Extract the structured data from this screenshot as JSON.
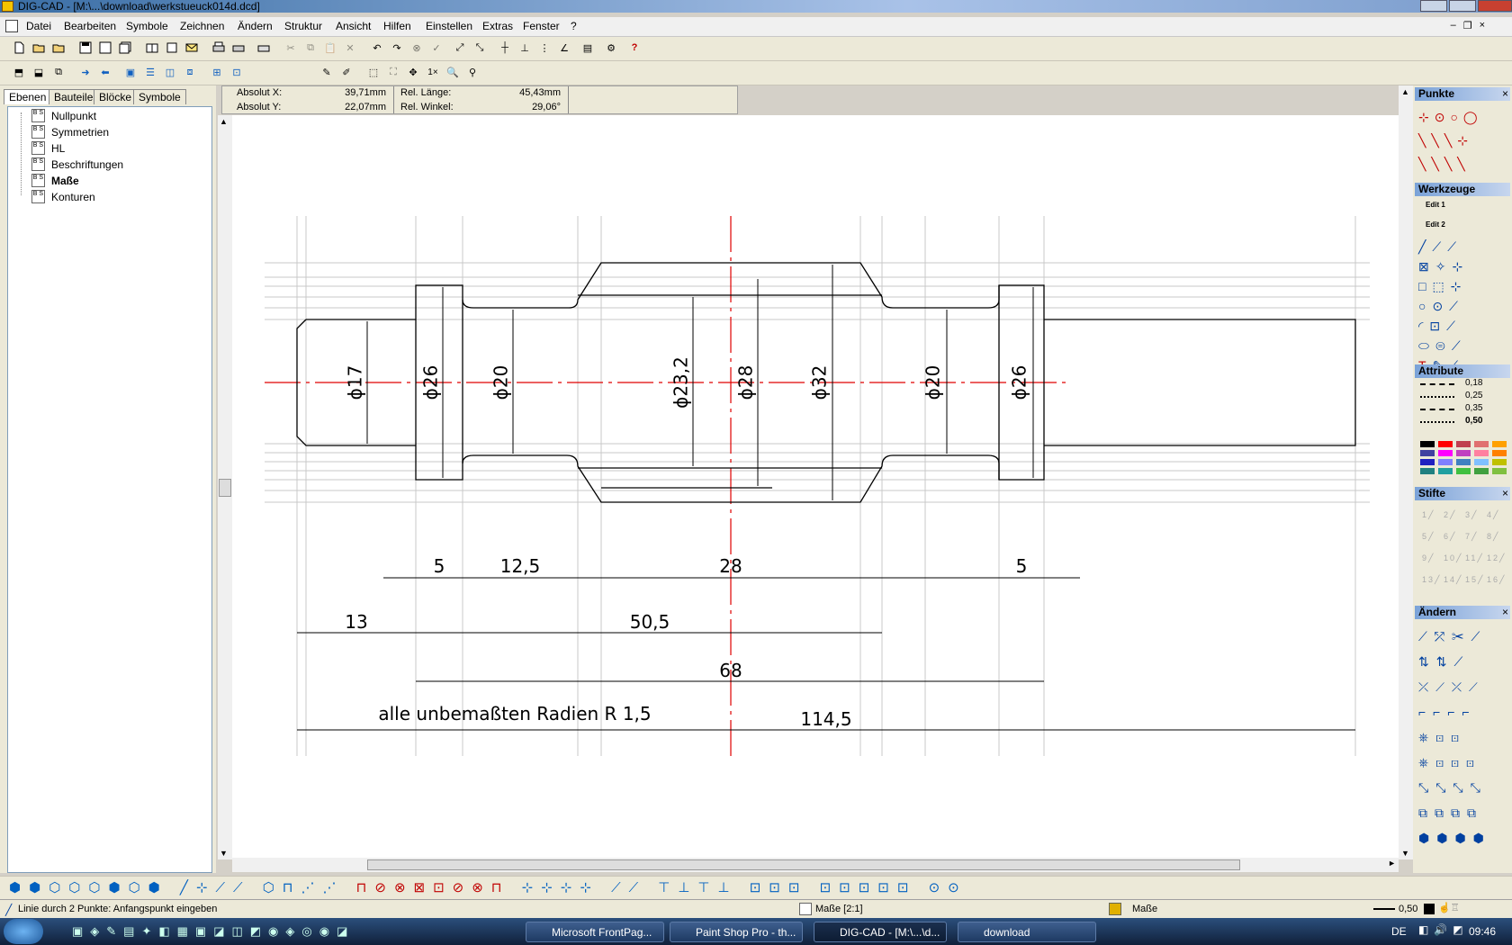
{
  "window": {
    "title": "DIG-CAD - [M:\\...\\download\\werkstueuck014d.dcd]"
  },
  "menu": [
    "Datei",
    "Bearbeiten",
    "Symbole",
    "Zeichnen",
    "Ändern",
    "Struktur",
    "Ansicht",
    "Hilfen",
    "Einstellen",
    "Extras",
    "Fenster",
    "?"
  ],
  "left_tabs": [
    "Ebenen",
    "Bauteile",
    "Blöcke",
    "Symbole"
  ],
  "layers": [
    {
      "name": "Nullpunkt",
      "bold": false
    },
    {
      "name": "Symmetrien",
      "bold": false
    },
    {
      "name": "HL",
      "bold": false
    },
    {
      "name": "Beschriftungen",
      "bold": false
    },
    {
      "name": "Maße",
      "bold": true
    },
    {
      "name": "Konturen",
      "bold": false
    }
  ],
  "coords": {
    "absx_label": "Absolut X:",
    "absx_value": "39,71mm",
    "absy_label": "Absolut Y:",
    "absy_value": "22,07mm",
    "rel_len_label": "Rel. Länge:",
    "rel_len_value": "45,43mm",
    "rel_angle_label": "Rel. Winkel:",
    "rel_angle_value": "29,06°"
  },
  "toolbar": {
    "zoom_label": "1×",
    "help": "?"
  },
  "drawing": {
    "diameters": [
      "ϕ17",
      "ϕ26",
      "ϕ20",
      "ϕ23,2",
      "ϕ28",
      "ϕ32",
      "ϕ20",
      "ϕ26"
    ],
    "lengths": [
      "5",
      "12,5",
      "28",
      "5",
      "13",
      "50,5",
      "68",
      "114,5"
    ],
    "note": "alle unbemaßten Radien R 1,5"
  },
  "right_panel": {
    "punkte": "Punkte",
    "werkzeuge": "Werkzeuge",
    "attribute": "Attribute",
    "stifte": "Stifte",
    "aendern": "Ändern",
    "close": "×",
    "linewidths": [
      "0,18",
      "0,25",
      "0,35",
      "0,50"
    ],
    "edit1": "Edit 1",
    "edit2": "Edit 2",
    "stift_labels": [
      "1",
      "2",
      "3",
      "4",
      "5",
      "6",
      "7",
      "8",
      "9",
      "10",
      "11",
      "12",
      "13",
      "14",
      "15",
      "16"
    ],
    "colors": [
      "#000000",
      "#ff0000",
      "#c04050",
      "#e07070",
      "#ffa000",
      "#4040a0",
      "#ff00ff",
      "#c040c0",
      "#ff80a0",
      "#ff8000",
      "#2020c0",
      "#8080ff",
      "#4080c0",
      "#80c0ff",
      "#c0c000",
      "#208080",
      "#20a0a0",
      "#40c040",
      "#40a040",
      "#80c040"
    ]
  },
  "status": {
    "prompt": "Linie durch 2 Punkte: Anfangspunkt eingeben",
    "layer": "Maße [2:1]",
    "layer2": "Maße",
    "linewidth": "0,50"
  },
  "taskbar": {
    "tasks": [
      "Microsoft FrontPag...",
      "Paint Shop Pro - th...",
      "DIG-CAD - [M:\\...\\d...",
      "download"
    ],
    "lang": "DE",
    "time": "09:46"
  }
}
